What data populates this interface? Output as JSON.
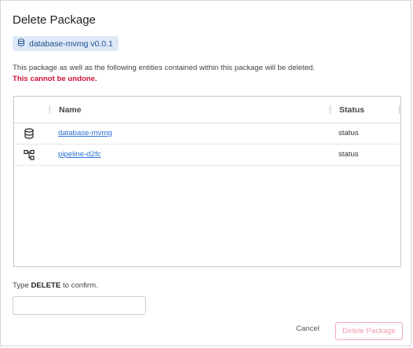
{
  "dialog": {
    "title": "Delete Package",
    "package_tag": {
      "label": "database-mvmg v0.0.1",
      "icon": "database-icon"
    },
    "description": "This package as well as the following entities contained within this package will be deleted.",
    "warning": "This cannot be undone.",
    "colors": {
      "warning": "#d0103a",
      "link": "#2a6fd6",
      "tag_bg": "#dde9f6",
      "delete_border": "#f1a8b6"
    }
  },
  "table": {
    "columns": [
      "Name",
      "Status"
    ],
    "rows": [
      {
        "icon": "database-icon",
        "name": "database-mvmg",
        "status": "status"
      },
      {
        "icon": "pipeline-icon",
        "name": "pipeline-d2fc",
        "status": "status"
      }
    ]
  },
  "confirm": {
    "label_prefix": "Type ",
    "keyword": "DELETE",
    "label_suffix": " to confirm.",
    "input_value": "",
    "input_placeholder": ""
  },
  "buttons": {
    "cancel": "Cancel",
    "delete": "Delete Package"
  }
}
